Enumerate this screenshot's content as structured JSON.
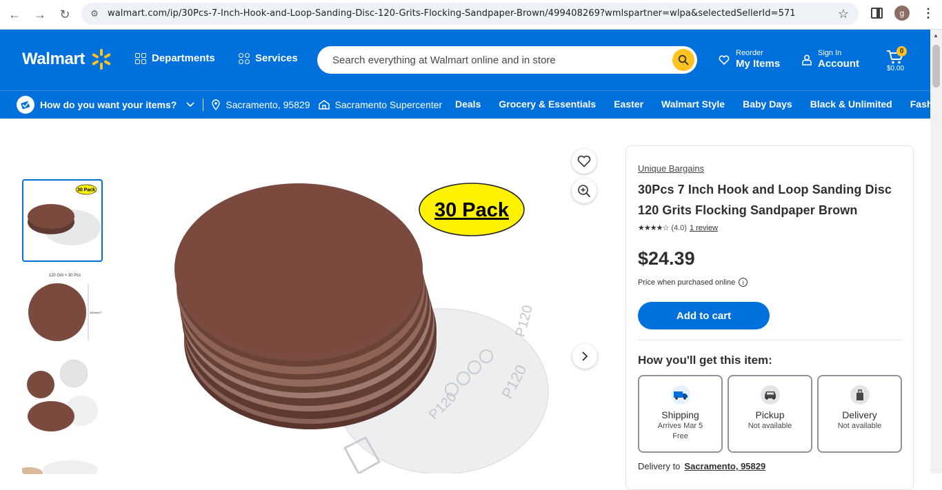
{
  "browser": {
    "url": "walmart.com/ip/30Pcs-7-Inch-Hook-and-Loop-Sanding-Disc-120-Grits-Flocking-Sandpaper-Brown/499408269?wmlspartner=wlpa&selectedSellerId=571",
    "profile_initial": "g"
  },
  "header": {
    "logo": "Walmart",
    "departments": "Departments",
    "services": "Services",
    "search_placeholder": "Search everything at Walmart online and in store",
    "reorder_small": "Reorder",
    "reorder_big": "My Items",
    "account_small": "Sign In",
    "account_big": "Account",
    "cart_count": "0",
    "cart_total": "$0.00"
  },
  "subheader": {
    "question": "How do you want your items?",
    "zip": "Sacramento, 95829",
    "store": "Sacramento Supercenter",
    "links": [
      "Deals",
      "Grocery & Essentials",
      "Easter",
      "Walmart Style",
      "Baby Days",
      "Black & Unlimited",
      "Fashion"
    ]
  },
  "gallery": {
    "badge_text": "30 Pack",
    "thumb1_badge": "30 Pack",
    "thumb2_caption": "120 Grit × 30 Pcs",
    "thumb2_dim": "180mm/7\"",
    "disc_text": "P120"
  },
  "product": {
    "seller": "Unique Bargains",
    "title": "30Pcs 7 Inch Hook and Loop Sanding Disc 120 Grits Flocking Sandpaper Brown",
    "rating_value": "(4.0)",
    "rating": 4.0,
    "reviews": "1 review",
    "price": "$24.39",
    "price_note": "Price when purchased online",
    "add_to_cart": "Add to cart",
    "how_title": "How you'll get this item:",
    "options": [
      {
        "label": "Shipping",
        "line1": "Arrives Mar 5",
        "line2": "Free"
      },
      {
        "label": "Pickup",
        "line1": "Not available",
        "line2": ""
      },
      {
        "label": "Delivery",
        "line1": "Not available",
        "line2": ""
      }
    ],
    "delivery_to_label": "Delivery to",
    "delivery_to_value": "Sacramento, 95829"
  },
  "colors": {
    "walmart_blue": "#0071dc",
    "spark_yellow": "#ffc220",
    "disc_brown": "#7b4a3e"
  }
}
